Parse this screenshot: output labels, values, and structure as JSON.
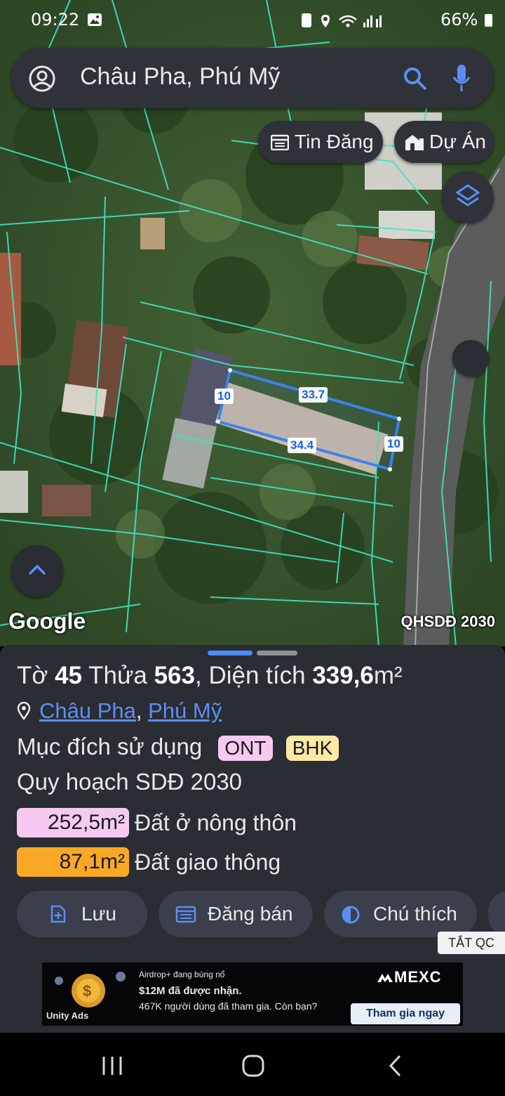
{
  "status_bar": {
    "time": "09:22",
    "battery": "66%"
  },
  "search": {
    "query": "Châu Pha, Phú Mỹ"
  },
  "map_buttons": {
    "listings": "Tin Đăng",
    "projects": "Dự Án"
  },
  "parcel_dimensions": {
    "top": "33.7",
    "bottom": "34.4",
    "left": "10",
    "right": "10"
  },
  "map_labels": {
    "brand": "Google",
    "plan": "QHSDĐ 2030"
  },
  "parcel": {
    "to_label": "Tờ",
    "to_value": "45",
    "thua_label": "Thửa",
    "thua_value": "563",
    "area_label": ", Diện tích",
    "area_value": "339,6",
    "unit": "m²",
    "location_commune": "Châu Pha",
    "location_town": "Phú Mỹ",
    "purpose_label": "Mục đích sử dụng",
    "purpose_tags": [
      "ONT",
      "BHK"
    ],
    "plan_label": "Quy hoạch SDĐ 2030",
    "breakdown": [
      {
        "area": "252,5m²",
        "label": "Đất ở nông thôn"
      },
      {
        "area": "87,1m²",
        "label": "Đất giao thông"
      }
    ]
  },
  "actions": {
    "save": "Lưu",
    "sell": "Đăng bán",
    "legend": "Chú thích"
  },
  "ads": {
    "close_label": "TẮT QC",
    "line1": "Airdrop+ đang bùng nổ",
    "line2": "$12M đã được nhận.",
    "line3": "467K người dùng đã tham gia. Còn bạn?",
    "brand": "MEXC",
    "cta": "Tham gia ngay",
    "network": "Unity Ads"
  },
  "colors": {
    "parcel_outline": "#3b82f6",
    "boundary": "#3ee6c0",
    "sheet_bg": "#2a2d33",
    "tag_ont": "#f6c9f1",
    "tag_bhk": "#fde9a6",
    "area_pink": "#f6c9f1",
    "area_orange": "#f9a825",
    "accent": "#5b8ef5"
  }
}
